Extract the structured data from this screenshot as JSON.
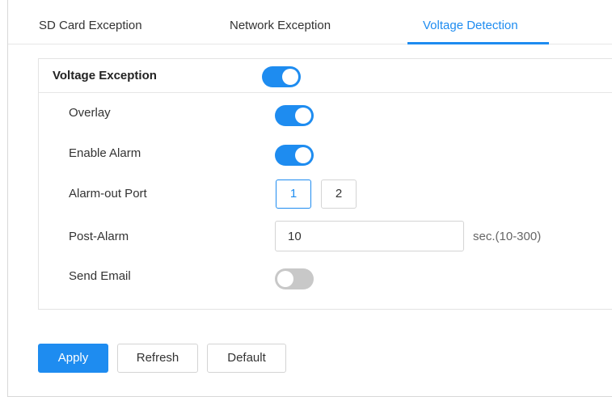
{
  "tabs": [
    {
      "label": "SD Card Exception",
      "active": false
    },
    {
      "label": "Network Exception",
      "active": false
    },
    {
      "label": "Voltage Detection",
      "active": true
    }
  ],
  "panel": {
    "title": "Voltage Exception",
    "enabled": true
  },
  "settings": {
    "overlay": {
      "label": "Overlay",
      "enabled": true
    },
    "enable_alarm": {
      "label": "Enable Alarm",
      "enabled": true
    },
    "alarm_out_port": {
      "label": "Alarm-out Port",
      "ports": [
        "1",
        "2"
      ],
      "selected": "1"
    },
    "post_alarm": {
      "label": "Post-Alarm",
      "value": "10",
      "hint": "sec.(10-300)"
    },
    "send_email": {
      "label": "Send Email",
      "enabled": false
    }
  },
  "buttons": {
    "apply": "Apply",
    "refresh": "Refresh",
    "default": "Default"
  },
  "colors": {
    "accent": "#1e8cf0",
    "toggle_off": "#c8c8c8"
  }
}
